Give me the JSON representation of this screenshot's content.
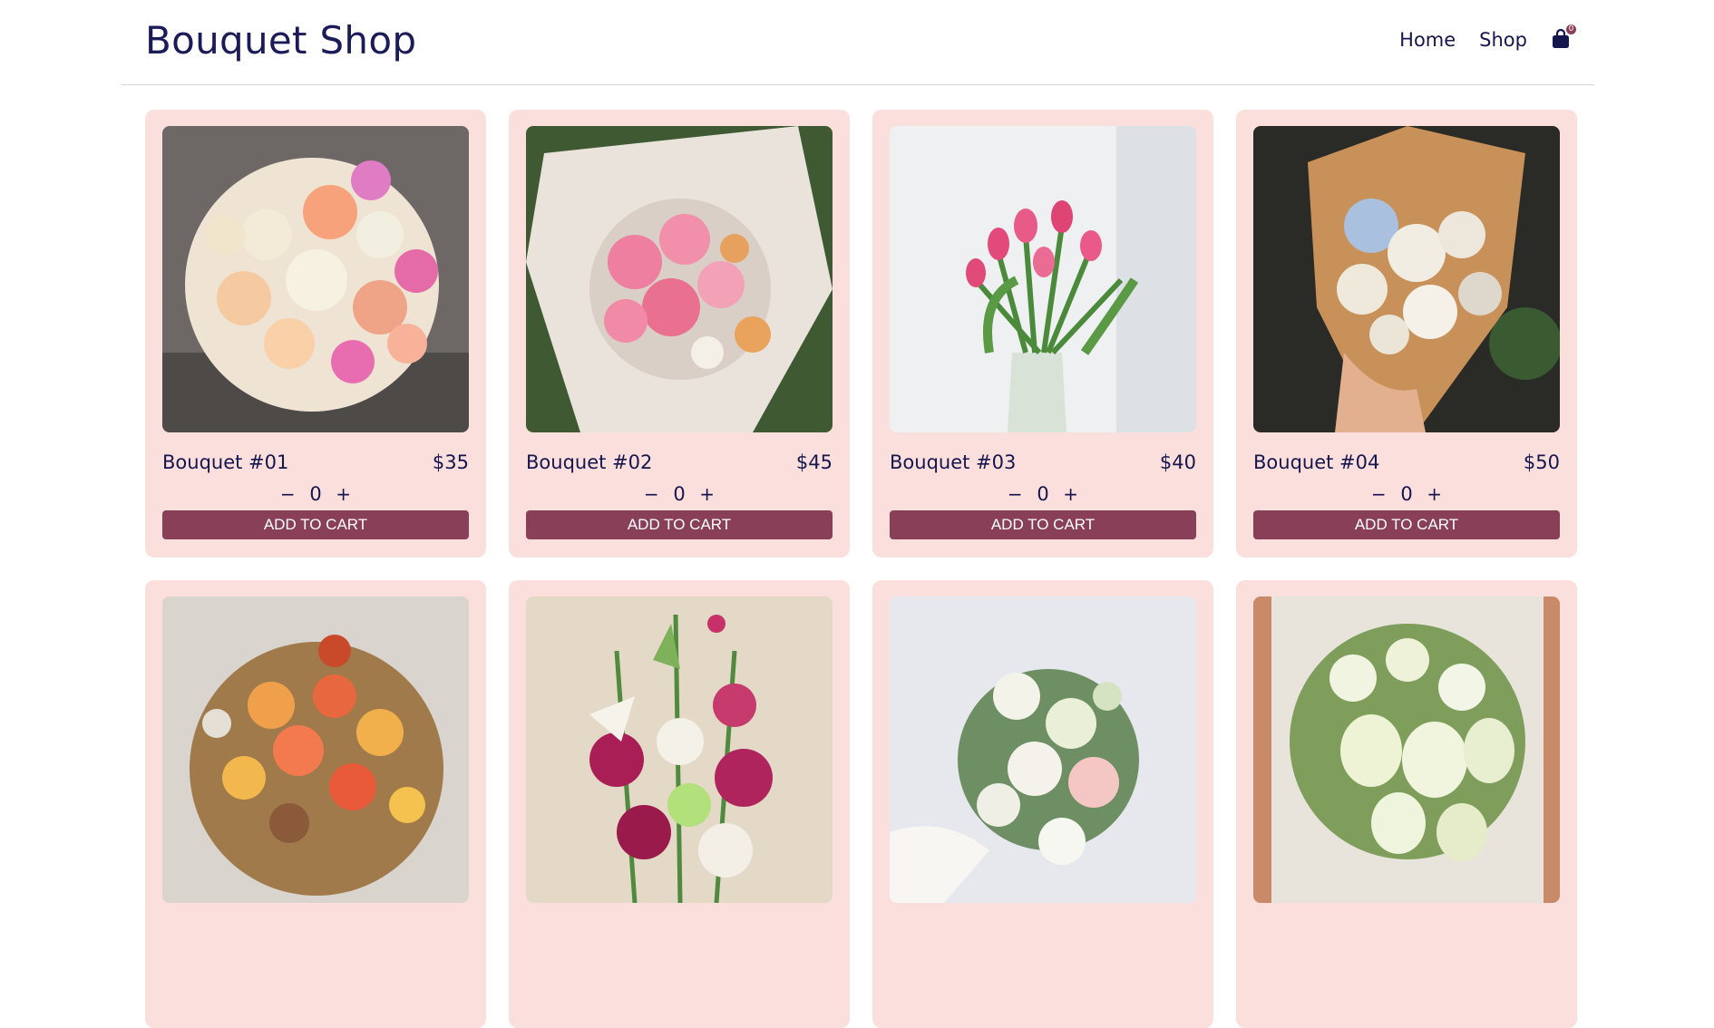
{
  "header": {
    "brand": "Bouquet Shop",
    "nav": {
      "home": "Home",
      "shop": "Shop"
    },
    "cart": {
      "icon": "shopping-bag-icon",
      "count": "0"
    }
  },
  "colors": {
    "card_bg": "#fbdfdc",
    "accent": "#8a3f59",
    "text": "#16164f"
  },
  "products": [
    {
      "name": "Bouquet #01",
      "price": "$35",
      "qty": "0",
      "minus": "−",
      "plus": "+",
      "cta": "ADD TO CART",
      "image": "pink-peach-rose-bouquet"
    },
    {
      "name": "Bouquet #02",
      "price": "$45",
      "qty": "0",
      "minus": "−",
      "plus": "+",
      "cta": "ADD TO CART",
      "image": "pink-rose-wrapped-bouquet"
    },
    {
      "name": "Bouquet #03",
      "price": "$40",
      "qty": "0",
      "minus": "−",
      "plus": "+",
      "cta": "ADD TO CART",
      "image": "pink-tulip-vase"
    },
    {
      "name": "Bouquet #04",
      "price": "$50",
      "qty": "0",
      "minus": "−",
      "plus": "+",
      "cta": "ADD TO CART",
      "image": "white-rose-kraft-bouquet"
    },
    {
      "name": "",
      "price": "",
      "qty": "",
      "minus": "",
      "plus": "",
      "cta": "",
      "image": "orange-autumn-bouquet"
    },
    {
      "name": "",
      "price": "",
      "qty": "",
      "minus": "",
      "plus": "",
      "cta": "",
      "image": "lily-carnation-arrangement"
    },
    {
      "name": "",
      "price": "",
      "qty": "",
      "minus": "",
      "plus": "",
      "cta": "",
      "image": "white-peony-bridal-bouquet"
    },
    {
      "name": "",
      "price": "",
      "qty": "",
      "minus": "",
      "plus": "",
      "cta": "",
      "image": "white-calla-lily-bouquet"
    }
  ]
}
